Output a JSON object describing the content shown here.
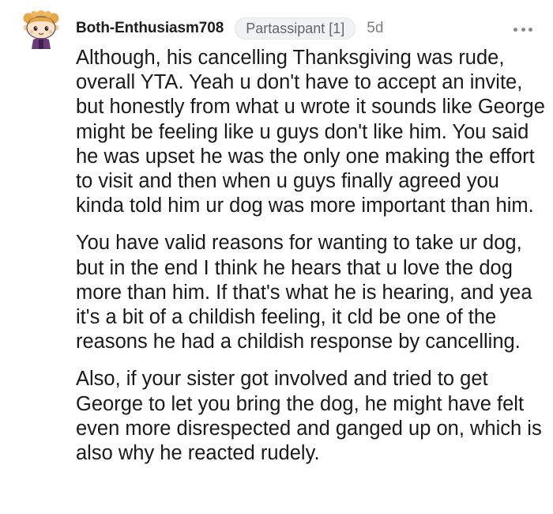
{
  "comment": {
    "author": "Both-Enthusiasm708",
    "flair": "Partassipant [1]",
    "age": "5d",
    "paragraphs": [
      "Although, his cancelling Thanksgiving was rude, overall YTA. Yeah u don't have to accept an invite, but honestly from what u wrote it sounds like George might be feeling like u guys don't like him. You said he was upset he was the only one making the effort to visit and then when u guys finally agreed you kinda told him ur dog was more important than him.",
      "You have valid reasons for wanting to take ur dog, but in the end I think he hears that u love the dog more than him. If that's what he is hearing, and yea it's a bit of a childish feeling, it cld be one of the reasons he had a childish response by cancelling.",
      "Also, if your sister got involved and tried to get George to let you bring the dog, he might have felt even more disrespected and ganged up on, which is also why he reacted rudely."
    ]
  },
  "icons": {
    "avatar": "snoo-avatar-icon",
    "menu": "more-options-icon"
  },
  "colors": {
    "text": "#1a1a1b",
    "username": "#1c1c1c",
    "flair_bg": "#f1f2f3",
    "flair_text": "#636669",
    "meta": "#7c7c7c",
    "menu_dots": "#878a8c"
  }
}
